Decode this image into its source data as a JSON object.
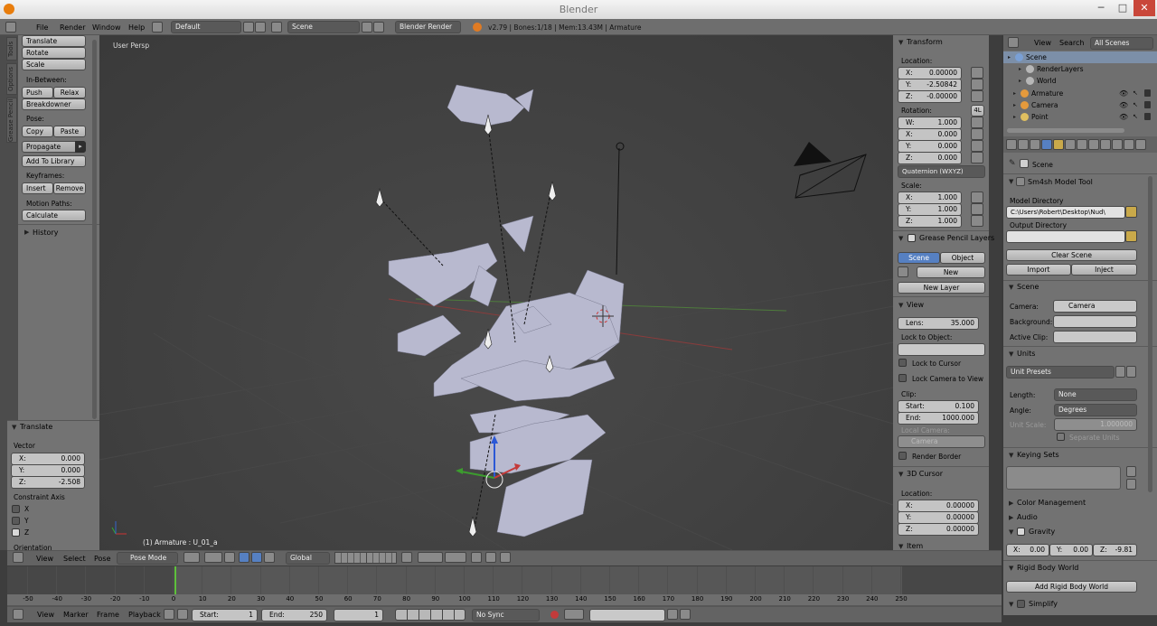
{
  "window": {
    "title": "Blender",
    "minimize": "─",
    "maximize": "□",
    "close": "✕"
  },
  "menubar": {
    "menus": [
      "File",
      "Render",
      "Window",
      "Help"
    ],
    "layout": "Default",
    "scene": "Scene",
    "engine": "Blender Render",
    "status": "v2.79 | Bones:1/18 | Mem:13.43M | Armature"
  },
  "toolshelf": {
    "tabs": [
      "Tools",
      "Options",
      "Grease Pencil"
    ],
    "translate": "Translate",
    "rotate": "Rotate",
    "scale": "Scale",
    "in_between": "In-Between:",
    "push": "Push",
    "relax": "Relax",
    "breakdowner": "Breakdowner",
    "pose": "Pose:",
    "copy": "Copy",
    "paste": "Paste",
    "propagate": "Propagate",
    "add_to_library": "Add To Library",
    "keyframes": "Keyframes:",
    "insert": "Insert",
    "remove": "Remove",
    "motion_paths": "Motion Paths:",
    "calculate": "Calculate",
    "history": "History"
  },
  "operator": {
    "title": "Translate",
    "vector": "Vector",
    "x_label": "X:",
    "x": "0.000",
    "y_label": "Y:",
    "y": "0.000",
    "z_label": "Z:",
    "z": "-2.508",
    "constraint": "Constraint Axis",
    "cx": "X",
    "cy": "Y",
    "cz": "Z",
    "orientation": "Orientation"
  },
  "viewport": {
    "view_name": "User Persp",
    "object_info": "(1) Armature : U_01_a"
  },
  "viewheader": {
    "view": "View",
    "select": "Select",
    "pose": "Pose",
    "mode": "Pose Mode",
    "orientation": "Global"
  },
  "npanel": {
    "transform": "Transform",
    "location": "Location:",
    "loc": [
      {
        "l": "X:",
        "v": "0.00000"
      },
      {
        "l": "Y:",
        "v": "-2.50842"
      },
      {
        "l": "Z:",
        "v": "-0.00000"
      }
    ],
    "rotation": "Rotation:",
    "rot_badge": "4L",
    "rot": [
      {
        "l": "W:",
        "v": "1.000"
      },
      {
        "l": "X:",
        "v": "0.000"
      },
      {
        "l": "Y:",
        "v": "0.000"
      },
      {
        "l": "Z:",
        "v": "0.000"
      }
    ],
    "rot_mode": "Quaternion (WXYZ)",
    "scale": "Scale:",
    "scl": [
      {
        "l": "X:",
        "v": "1.000"
      },
      {
        "l": "Y:",
        "v": "1.000"
      },
      {
        "l": "Z:",
        "v": "1.000"
      }
    ],
    "gp_layers": "Grease Pencil Layers",
    "scene_tab": "Scene",
    "object_tab": "Object",
    "new": "New",
    "new_layer": "New Layer",
    "view": "View",
    "lens_label": "Lens:",
    "lens": "35.000",
    "lock_object": "Lock to Object:",
    "lock_cursor": "Lock to Cursor",
    "lock_camera": "Lock Camera to View",
    "clip": "Clip:",
    "start_label": "Start:",
    "start": "0.100",
    "end_label": "End:",
    "end": "1000.000",
    "local_camera": "Local Camera:",
    "camera": "Camera",
    "render_border": "Render Border",
    "cursor": "3D Cursor",
    "cursor_location": "Location:",
    "cur": [
      {
        "l": "X:",
        "v": "0.00000"
      },
      {
        "l": "Y:",
        "v": "0.00000"
      },
      {
        "l": "Z:",
        "v": "0.00000"
      }
    ],
    "item": "Item"
  },
  "outliner": {
    "view": "View",
    "search": "Search",
    "filter": "All Scenes",
    "items": [
      "Scene",
      "RenderLayers",
      "World",
      "Armature",
      "Camera",
      "Point"
    ]
  },
  "properties": {
    "breadcrumb": "Scene",
    "tool_title": "Sm4sh Model Tool",
    "model_dir_label": "Model Directory",
    "model_dir": "C:\\Users\\Robert\\Desktop\\Nud\\",
    "output_dir_label": "Output Directory",
    "clear_scene": "Clear Scene",
    "import": "Import",
    "inject": "Inject",
    "scene_title": "Scene",
    "camera_label": "Camera:",
    "camera": "Camera",
    "background_label": "Background:",
    "active_clip_label": "Active Clip:",
    "units": "Units",
    "unit_presets": "Unit Presets",
    "length_label": "Length:",
    "length": "None",
    "angle_label": "Angle:",
    "angle": "Degrees",
    "unit_scale_label": "Unit Scale:",
    "unit_scale": "1.000000",
    "separate_units": "Separate Units",
    "keying_sets": "Keying Sets",
    "color_management": "Color Management",
    "audio": "Audio",
    "gravity": "Gravity",
    "gx": "X:",
    "gxv": "0.00",
    "gy": "Y:",
    "gyv": "0.00",
    "gz": "Z:",
    "gzv": "-9.81",
    "rigid_body": "Rigid Body World",
    "add_rigid": "Add Rigid Body World",
    "simplify": "Simplify"
  },
  "timeline": {
    "ticks": [
      "-50",
      "-40",
      "-30",
      "-20",
      "-10",
      "0",
      "10",
      "20",
      "30",
      "40",
      "50",
      "60",
      "70",
      "80",
      "90",
      "100",
      "110",
      "120",
      "130",
      "140",
      "150",
      "160",
      "170",
      "180",
      "190",
      "200",
      "210",
      "220",
      "230",
      "240",
      "250"
    ],
    "view": "View",
    "marker": "Marker",
    "frame": "Frame",
    "playback": "Playback",
    "start_label": "Start:",
    "start": "1",
    "end_label": "End:",
    "end": "250",
    "current": "1",
    "sync": "No Sync"
  }
}
